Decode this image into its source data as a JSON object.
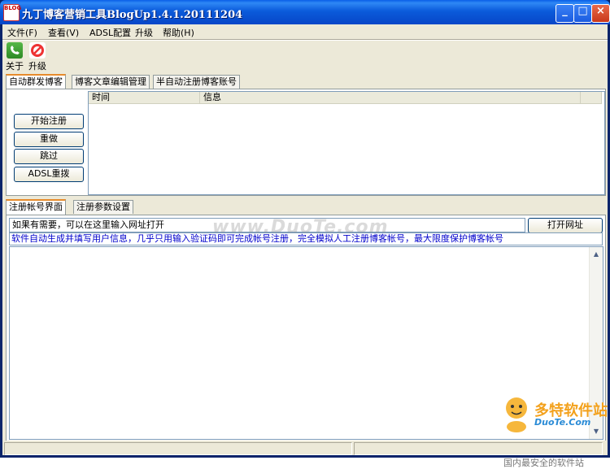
{
  "window": {
    "title": "九丁博客营销工具BlogUp1.4.1.20111204",
    "app_icon_text": "BLOG",
    "buttons": {
      "minimize": "_",
      "maximize": "□",
      "close": "×"
    }
  },
  "menu": [
    "文件(F)",
    "查看(V)",
    "ADSL配置",
    "升级",
    "帮助(H)"
  ],
  "toolbar": {
    "about_label": "关于",
    "upgrade_label": "升级"
  },
  "main_tabs": [
    "自动群发博客",
    "博客文章编辑管理",
    "半自动注册博客账号"
  ],
  "actions": [
    "开始注册",
    "重做",
    "跳过",
    "ADSL重拨"
  ],
  "log_table": {
    "columns": [
      "时间",
      "信息"
    ],
    "rows": []
  },
  "sub_tabs": [
    "注册帐号界面",
    "注册参数设置"
  ],
  "url_input": {
    "value": "如果有需要，可以在这里输入网址打开"
  },
  "open_button": "打开网址",
  "description": "软件自动生成并填写用户信息，几乎只用输入验证码即可完成帐号注册，完全模拟人工注册博客帐号，最大限度保护博客帐号",
  "watermark": "www.DuoTe.com",
  "brand": {
    "name": "多特软件站",
    "domain": "DuoTe.Com",
    "tagline": "国内最安全的软件站"
  },
  "colors": {
    "title_blue": "#0b5bdb",
    "description_text": "#0000cc",
    "tab_highlight": "#e68b2c"
  }
}
